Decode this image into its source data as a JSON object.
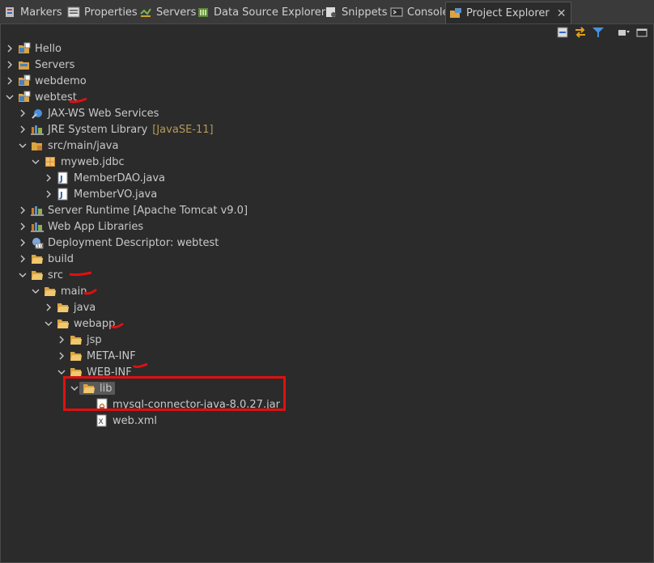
{
  "tabs": [
    {
      "label": "Markers",
      "icon": "markers-icon"
    },
    {
      "label": "Properties",
      "icon": "properties-icon"
    },
    {
      "label": "Servers",
      "icon": "servers-icon"
    },
    {
      "label": "Data Source Explorer",
      "icon": "data-source-explorer-icon"
    },
    {
      "label": "Snippets",
      "icon": "snippets-icon"
    },
    {
      "label": "Console",
      "icon": "console-icon"
    },
    {
      "label": "Project Explorer",
      "icon": "project-explorer-icon",
      "active": true
    }
  ],
  "toolbar": [
    "collapse-all-icon",
    "link-with-editor-icon",
    "filter-icon",
    "view-menu-icon",
    "minimize-icon"
  ],
  "tree": [
    {
      "label": "Hello",
      "icon": "web-project-icon",
      "expanded": false
    },
    {
      "label": "Servers",
      "icon": "servers-folder-icon",
      "expanded": false
    },
    {
      "label": "webdemo",
      "icon": "web-project-icon",
      "expanded": false
    },
    {
      "label": "webtest",
      "icon": "web-project-icon",
      "expanded": true
    },
    {
      "label": "JAX-WS Web Services",
      "icon": "jaxws-icon",
      "expanded": false
    },
    {
      "label": "JRE System Library",
      "decoration": "[JavaSE-11]",
      "icon": "library-icon",
      "expanded": false
    },
    {
      "label": "src/main/java",
      "icon": "source-folder-icon",
      "expanded": true
    },
    {
      "label": "myweb.jdbc",
      "icon": "package-icon",
      "expanded": true
    },
    {
      "label": "MemberDAO.java",
      "icon": "java-file-icon",
      "expanded": false
    },
    {
      "label": "MemberVO.java",
      "icon": "java-file-icon",
      "expanded": false
    },
    {
      "label": "Server Runtime [Apache Tomcat v9.0]",
      "icon": "library-icon",
      "expanded": false
    },
    {
      "label": "Web App Libraries",
      "icon": "library-icon",
      "expanded": false
    },
    {
      "label": "Deployment Descriptor: webtest",
      "icon": "deployment-descriptor-icon",
      "expanded": false
    },
    {
      "label": "build",
      "icon": "folder-icon",
      "expanded": false
    },
    {
      "label": "src",
      "icon": "folder-icon",
      "expanded": true
    },
    {
      "label": "main",
      "icon": "folder-icon",
      "expanded": true
    },
    {
      "label": "java",
      "icon": "folder-icon",
      "expanded": false
    },
    {
      "label": "webapp",
      "icon": "folder-icon",
      "expanded": true
    },
    {
      "label": "jsp",
      "icon": "folder-icon",
      "expanded": false
    },
    {
      "label": "META-INF",
      "icon": "folder-icon",
      "expanded": false
    },
    {
      "label": "WEB-INF",
      "icon": "folder-icon",
      "expanded": true
    },
    {
      "label": "lib",
      "icon": "folder-icon",
      "expanded": true,
      "selected": true
    },
    {
      "label": "mysql-connector-java-8.0.27.jar",
      "icon": "jar-file-icon"
    },
    {
      "label": "web.xml",
      "icon": "xml-file-icon"
    }
  ],
  "colors": {
    "background": "#2b2b2b",
    "tabbar": "#3a3a3a",
    "annotation": "#e01010",
    "decoration": "#b59a5a"
  }
}
